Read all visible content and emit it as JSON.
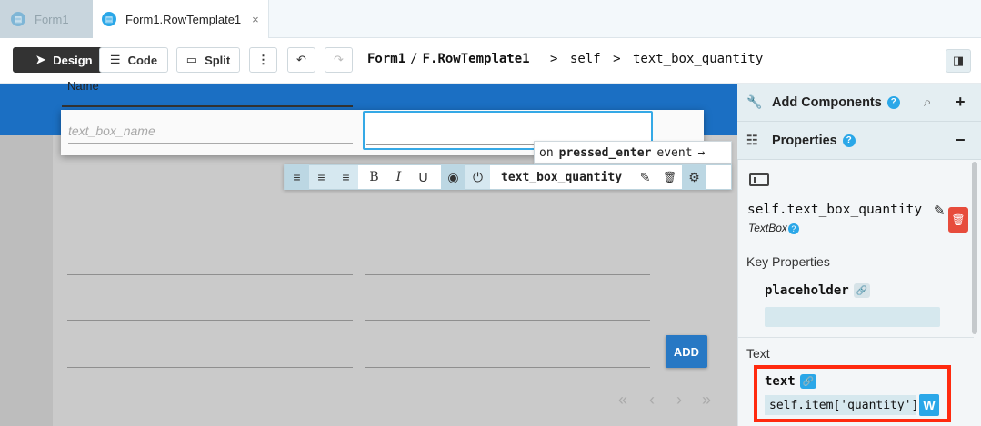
{
  "tabs": [
    {
      "label": "Form1",
      "active": false
    },
    {
      "label": "Form1.RowTemplate1",
      "active": true,
      "close_icon": "×"
    }
  ],
  "toolbar": {
    "design_label": "Design",
    "code_label": "Code",
    "split_label": "Split",
    "more_icon": "⋮",
    "undo_icon": "↶",
    "redo_icon": "↷",
    "breadcrumb": {
      "form": "Form1",
      "slash": "/",
      "template": "F.RowTemplate1",
      "chevron1": ">",
      "self": "self",
      "chevron2": ">",
      "component": "text_box_quantity"
    }
  },
  "canvas": {
    "column_header": "Name",
    "name_placeholder": "text_box_name",
    "add_button": "ADD",
    "pager": {
      "first": "«",
      "prev": "‹",
      "next": "›",
      "last": "»"
    }
  },
  "event_hint": {
    "prefix": "on",
    "event": "pressed_enter",
    "suffix": "event",
    "arrow": "→"
  },
  "format_toolbar": {
    "align_left_icon": "≡",
    "align_center_icon": "≡",
    "align_right_icon": "≡",
    "bold": "B",
    "italic": "I",
    "underline": "U",
    "visible_icon": "◉",
    "enabled_icon": "⏻",
    "component_name": "text_box_quantity",
    "edit_icon": "✎",
    "delete_icon": "🗑",
    "settings_icon": "⚙"
  },
  "right_panel": {
    "add_components": {
      "title": "Add Components",
      "help": "?",
      "search_icon": "⌕",
      "plus": "+"
    },
    "properties": {
      "title": "Properties",
      "help": "?",
      "minus": "−"
    },
    "component": {
      "name": "self.text_box_quantity",
      "type": "TextBox",
      "type_help": "?",
      "edit_icon": "✎",
      "delete_icon": "🗑"
    },
    "key_properties_title": "Key Properties",
    "placeholder_label": "placeholder",
    "text_section_title": "Text",
    "text_label": "text",
    "text_value": "self.item['quantity']",
    "writeback_label": "W"
  },
  "colors": {
    "accent": "#2aa7e8",
    "blue_header": "#1b6fc3",
    "highlight": "#ff2a0f",
    "add_button": "#2778c4"
  }
}
